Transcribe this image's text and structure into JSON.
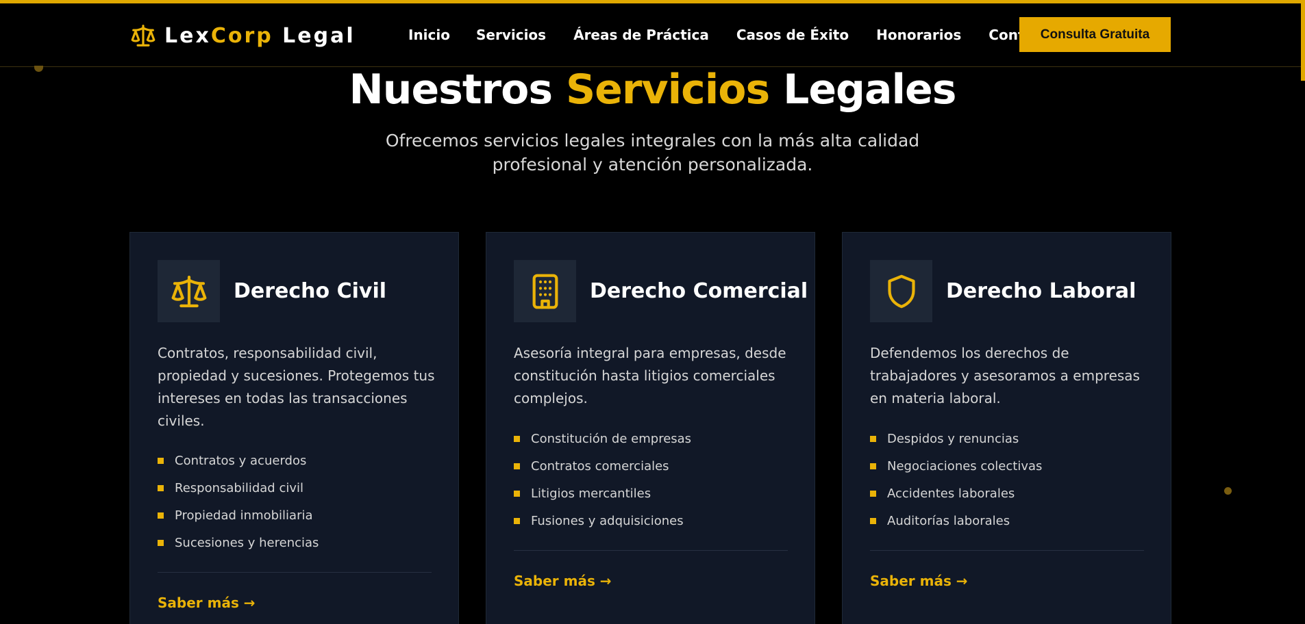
{
  "brand": {
    "part1": "Lex",
    "part2": "Corp",
    "part3": " Legal"
  },
  "nav": [
    "Inicio",
    "Servicios",
    "Áreas de Práctica",
    "Casos de Éxito",
    "Honorarios",
    "Contacto"
  ],
  "cta_label": "Consulta Gratuita",
  "hero": {
    "title_part1": "Nuestros ",
    "title_highlight": "Servicios",
    "title_part2": " Legales",
    "subtitle": "Ofrecemos servicios legales integrales con la más alta calidad profesional y atención personalizada."
  },
  "cards": [
    {
      "icon": "scale-icon",
      "title": "Derecho Civil",
      "description": "Contratos, responsabilidad civil, propiedad y sucesiones. Protegemos tus intereses en todas las transacciones civiles.",
      "features": [
        "Contratos y acuerdos",
        "Responsabilidad civil",
        "Propiedad inmobiliaria",
        "Sucesiones y herencias"
      ],
      "link": "Saber más →"
    },
    {
      "icon": "building-icon",
      "title": "Derecho Comercial",
      "description": "Asesoría integral para empresas, desde constitución hasta litigios comerciales complejos.",
      "features": [
        "Constitución de empresas",
        "Contratos comerciales",
        "Litigios mercantiles",
        "Fusiones y adquisiciones"
      ],
      "link": "Saber más →"
    },
    {
      "icon": "shield-icon",
      "title": "Derecho Laboral",
      "description": "Defendemos los derechos de trabajadores y asesoramos a empresas en materia laboral.",
      "features": [
        "Despidos y renuncias",
        "Negociaciones colectivas",
        "Accidentes laborales",
        "Auditorías laborales"
      ],
      "link": "Saber más →"
    }
  ],
  "colors": {
    "accent": "#eab308",
    "card_bg": "#111827",
    "page_bg": "#000000"
  }
}
